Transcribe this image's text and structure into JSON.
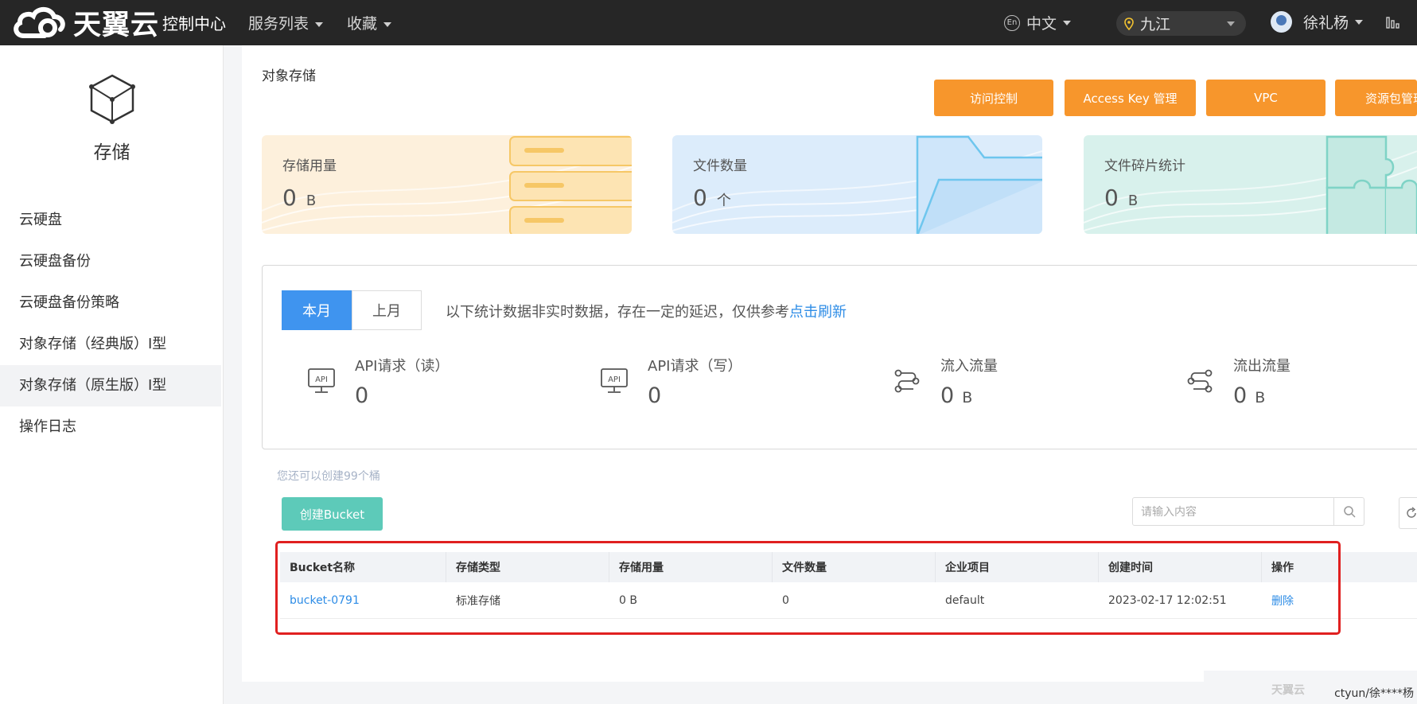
{
  "header": {
    "brand": "天翼云",
    "console": "控制中心",
    "nav": [
      "服务列表",
      "收藏"
    ],
    "language": "中文",
    "region": "九江",
    "user": "徐礼杨"
  },
  "sidebar": {
    "title": "存储",
    "items": [
      {
        "label": "云硬盘"
      },
      {
        "label": "云硬盘备份"
      },
      {
        "label": "云硬盘备份策略"
      },
      {
        "label": "对象存储（经典版）Ⅰ型"
      },
      {
        "label": "对象存储（原生版）Ⅰ型"
      },
      {
        "label": "操作日志"
      }
    ]
  },
  "main": {
    "title": "对象存储",
    "actions": [
      "访问控制",
      "Access Key 管理",
      "VPC",
      "资源包管理"
    ],
    "stats": [
      {
        "label": "存储用量",
        "value": "0",
        "unit": "B"
      },
      {
        "label": "文件数量",
        "value": "0",
        "unit": "个"
      },
      {
        "label": "文件碎片统计",
        "value": "0",
        "unit": "B"
      }
    ],
    "period": {
      "this_month": "本月",
      "last_month": "上月"
    },
    "notice": "以下统计数据非实时数据，存在一定的延迟，仅供参考",
    "refresh_link": "点击刷新",
    "metrics": [
      {
        "label": "API请求（读）",
        "value": "0",
        "unit": ""
      },
      {
        "label": "API请求（写）",
        "value": "0",
        "unit": ""
      },
      {
        "label": "流入流量",
        "value": "0",
        "unit": "B"
      },
      {
        "label": "流出流量",
        "value": "0",
        "unit": "B"
      }
    ],
    "quota_text": "您还可以创建99个桶",
    "create_button": "创建Bucket",
    "search_placeholder": "请输入内容",
    "table": {
      "headers": [
        "Bucket名称",
        "存储类型",
        "存储用量",
        "文件数量",
        "企业项目",
        "创建时间",
        "操作"
      ],
      "rows": [
        [
          "bucket-0791",
          "标准存储",
          "0 B",
          "0",
          "default",
          "2023-02-17 12:02:51",
          "删除"
        ]
      ]
    }
  },
  "watermark": {
    "logo": "天翼云",
    "text": "ctyun/徐****杨"
  },
  "colors": {
    "topbar": "#262626",
    "accent_orange": "#f7962c",
    "accent_blue": "#3f94ef",
    "accent_teal": "#5dcab9",
    "link": "#2d8ce6",
    "highlight": "#e02020"
  },
  "icons": {
    "search": "search-icon",
    "refresh": "refresh-icon",
    "location": "location-pin-icon",
    "api": "api-monitor-icon",
    "flow": "flow-icon",
    "storage": "cube-icon"
  }
}
